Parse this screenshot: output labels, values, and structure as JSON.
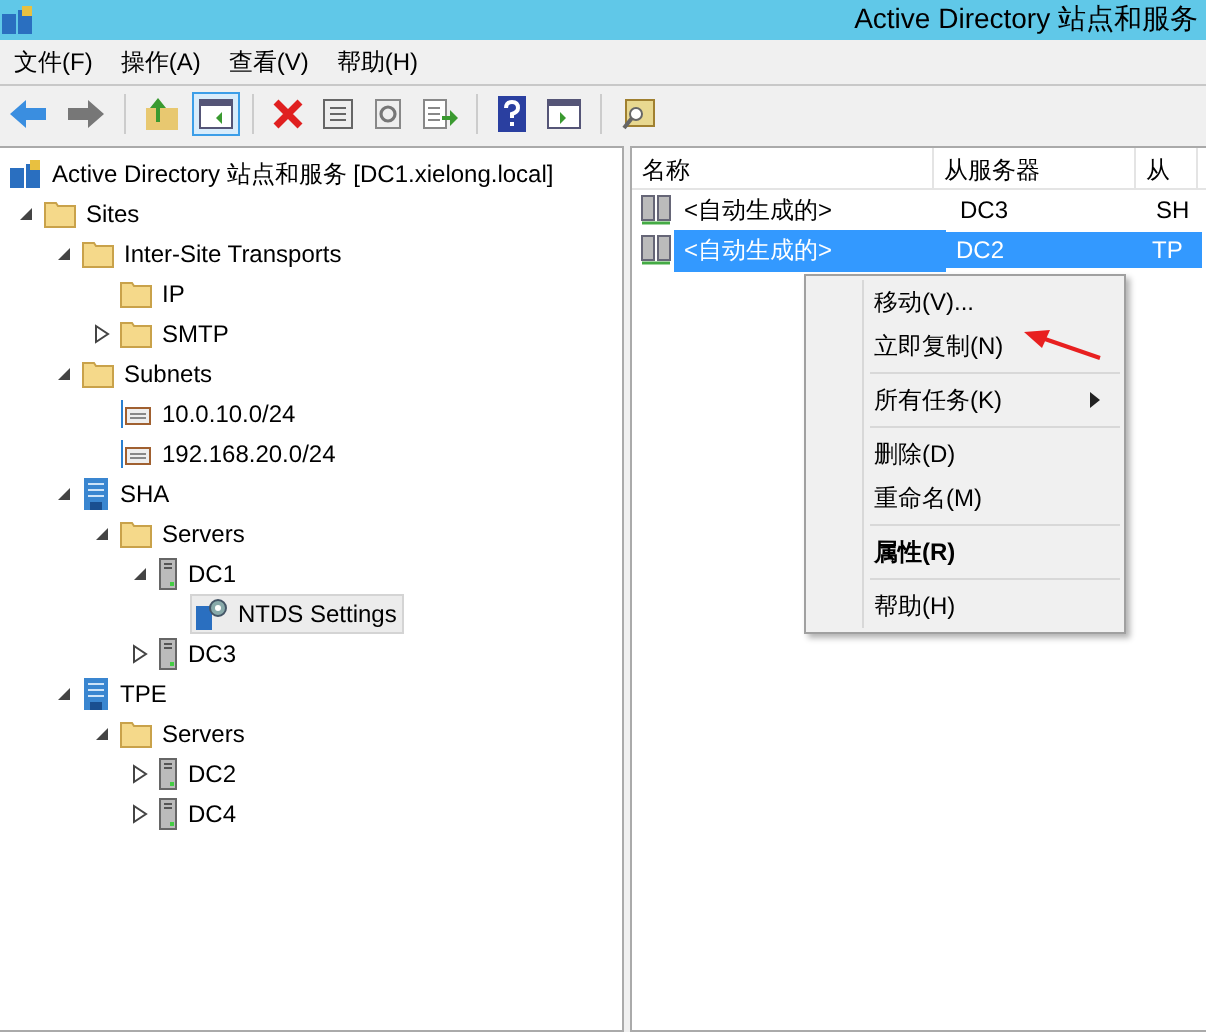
{
  "window": {
    "title": "Active Directory 站点和服务"
  },
  "menu": [
    "文件(F)",
    "操作(A)",
    "查看(V)",
    "帮助(H)"
  ],
  "toolbar": [
    {
      "kind": "back",
      "pressed": false
    },
    {
      "kind": "forward",
      "pressed": false
    },
    {
      "kind": "sep"
    },
    {
      "kind": "up",
      "pressed": false
    },
    {
      "kind": "tree",
      "pressed": true
    },
    {
      "kind": "sep"
    },
    {
      "kind": "delete",
      "pressed": false
    },
    {
      "kind": "props",
      "pressed": false
    },
    {
      "kind": "refresh",
      "pressed": false
    },
    {
      "kind": "export",
      "pressed": false
    },
    {
      "kind": "sep"
    },
    {
      "kind": "help",
      "pressed": false
    },
    {
      "kind": "pane",
      "pressed": false
    },
    {
      "kind": "sep"
    },
    {
      "kind": "find",
      "pressed": false
    }
  ],
  "tree": [
    {
      "label": "Active Directory 站点和服务 [DC1.xielong.local]",
      "kind": "root",
      "selected": false,
      "children": [
        {
          "label": "Sites",
          "kind": "folder",
          "expanded": true,
          "selected": false,
          "children": [
            {
              "label": "Inter-Site Transports",
              "kind": "folder",
              "expanded": true,
              "selected": false,
              "children": [
                {
                  "label": "IP",
                  "kind": "folder",
                  "selected": false
                },
                {
                  "label": "SMTP",
                  "kind": "folder",
                  "expanded": false,
                  "selected": false
                }
              ]
            },
            {
              "label": "Subnets",
              "kind": "folder",
              "expanded": true,
              "selected": false,
              "children": [
                {
                  "label": "10.0.10.0/24",
                  "kind": "subnet",
                  "selected": false
                },
                {
                  "label": "192.168.20.0/24",
                  "kind": "subnet",
                  "selected": false
                }
              ]
            },
            {
              "label": "SHA",
              "kind": "site",
              "expanded": true,
              "selected": false,
              "children": [
                {
                  "label": "Servers",
                  "kind": "folder",
                  "expanded": true,
                  "selected": false,
                  "children": [
                    {
                      "label": "DC1",
                      "kind": "server",
                      "expanded": true,
                      "selected": false,
                      "children": [
                        {
                          "label": "NTDS Settings",
                          "kind": "settings",
                          "selected": true
                        }
                      ]
                    },
                    {
                      "label": "DC3",
                      "kind": "server",
                      "expanded": false,
                      "selected": false
                    }
                  ]
                }
              ]
            },
            {
              "label": "TPE",
              "kind": "site",
              "expanded": true,
              "selected": false,
              "children": [
                {
                  "label": "Servers",
                  "kind": "folder",
                  "expanded": true,
                  "selected": false,
                  "children": [
                    {
                      "label": "DC2",
                      "kind": "server",
                      "expanded": false,
                      "selected": false
                    },
                    {
                      "label": "DC4",
                      "kind": "server",
                      "expanded": false,
                      "selected": false
                    }
                  ]
                }
              ]
            }
          ]
        }
      ]
    }
  ],
  "list": {
    "columns": [
      "名称",
      "从服务器",
      "从"
    ],
    "rows": [
      {
        "cells": [
          "<自动生成的>",
          "DC3",
          "SH"
        ],
        "selected": false
      },
      {
        "cells": [
          "<自动生成的>",
          "DC2",
          "TP"
        ],
        "selected": true
      }
    ]
  },
  "context_menu": [
    {
      "kind": "item",
      "label": "移动(V)...",
      "bold": false,
      "submenu": false
    },
    {
      "kind": "item",
      "label": "立即复制(N)",
      "bold": false,
      "submenu": false,
      "pointed": true
    },
    {
      "kind": "separator"
    },
    {
      "kind": "item",
      "label": "所有任务(K)",
      "bold": false,
      "submenu": true
    },
    {
      "kind": "separator"
    },
    {
      "kind": "item",
      "label": "删除(D)",
      "bold": false,
      "submenu": false
    },
    {
      "kind": "item",
      "label": "重命名(M)",
      "bold": false,
      "submenu": false
    },
    {
      "kind": "separator"
    },
    {
      "kind": "item",
      "label": "属性(R)",
      "bold": true,
      "submenu": false
    },
    {
      "kind": "separator"
    },
    {
      "kind": "item",
      "label": "帮助(H)",
      "bold": false,
      "submenu": false
    }
  ]
}
